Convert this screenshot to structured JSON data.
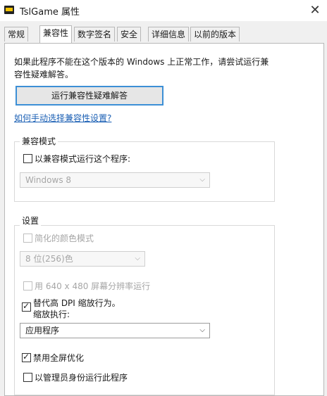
{
  "window": {
    "title": "TslGame 属性",
    "close_glyph": "✕"
  },
  "tabs": [
    {
      "label": "常规",
      "active": false
    },
    {
      "label": "兼容性",
      "active": true
    },
    {
      "label": "数字签名",
      "active": false
    },
    {
      "label": "安全",
      "active": false
    },
    {
      "label": "详细信息",
      "active": false
    },
    {
      "label": "以前的版本",
      "active": false
    }
  ],
  "compat": {
    "intro_line1": "如果此程序不能在这个版本的 Windows 上正常工作，请尝试运行兼",
    "intro_line2": "容性疑难解答。",
    "troubleshoot_button": "运行兼容性疑难解答",
    "manual_link": "如何手动选择兼容性设置?",
    "mode_group": {
      "legend": "兼容模式",
      "checkbox_label": "以兼容模式运行这个程序:",
      "checked": false,
      "os_select": "Windows 8"
    },
    "settings_group": {
      "legend": "设置",
      "reduced_color_label": "简化的颜色模式",
      "color_select": "8 位(256)色",
      "res_640_label": "用 640 x 480 屏幕分辨率运行",
      "dpi_override_label": "替代高 DPI 缩放行为。",
      "dpi_scaling_by_label": "缩放执行:",
      "dpi_override_checked": true,
      "dpi_select": "应用程序",
      "disable_fullscreen_label": "禁用全屏优化",
      "disable_fullscreen_checked": true,
      "run_as_admin_label": "以管理员身份运行此程序",
      "run_as_admin_checked": false
    }
  },
  "colors": {
    "highlight": "#d84a4a",
    "button_border": "#3c8fd6",
    "link": "#1a5fb4"
  }
}
